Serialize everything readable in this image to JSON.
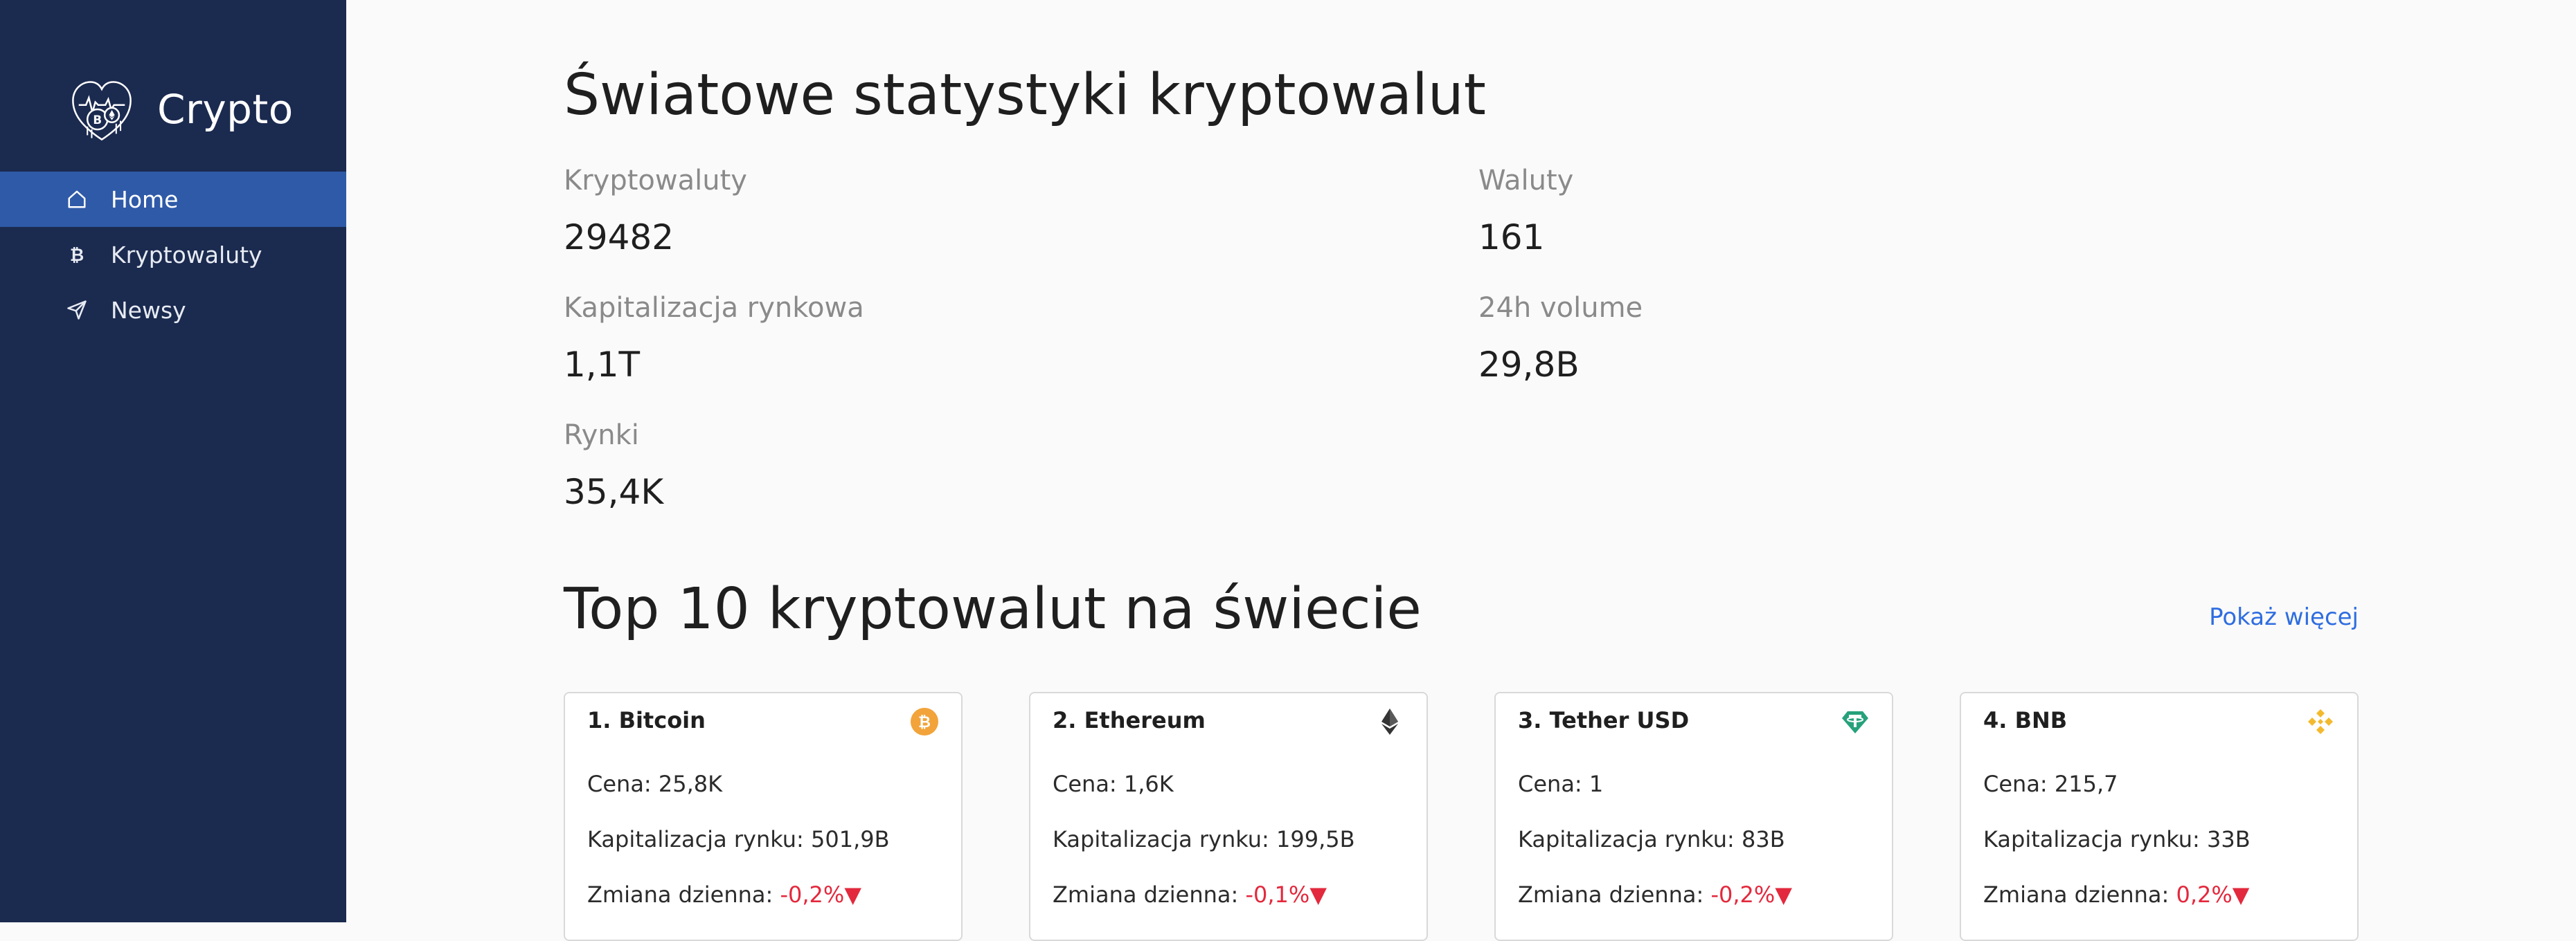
{
  "sidebar": {
    "brand": "Crypto",
    "items": [
      {
        "label": "Home",
        "icon": "home-icon",
        "active": true
      },
      {
        "label": "Kryptowaluty",
        "icon": "bitcoin-icon",
        "active": false
      },
      {
        "label": "Newsy",
        "icon": "send-icon",
        "active": false
      }
    ]
  },
  "main": {
    "title": "Światowe statystyki kryptowalut",
    "stats": {
      "cryptos": {
        "label": "Kryptowaluty",
        "value": "29482"
      },
      "currencies": {
        "label": "Waluty",
        "value": "161"
      },
      "market_cap": {
        "label": "Kapitalizacja rynkowa",
        "value": "1,1T"
      },
      "volume": {
        "label": "24h volume",
        "value": "29,8B"
      },
      "markets": {
        "label": "Rynki",
        "value": "35,4K"
      }
    },
    "top_title": "Top 10 kryptowalut na świecie",
    "show_more": "Pokaż więcej",
    "cards": [
      {
        "title": "1. Bitcoin",
        "icon": "bitcoin-coin-icon",
        "price": "Cena: 25,8K",
        "cap": "Kapitalizacja rynku: 501,9B",
        "change_label": "Zmiana dzienna: ",
        "change_value": "-0,2%"
      },
      {
        "title": "2. Ethereum",
        "icon": "ethereum-icon",
        "price": "Cena: 1,6K",
        "cap": "Kapitalizacja rynku: 199,5B",
        "change_label": "Zmiana dzienna: ",
        "change_value": "-0,1%"
      },
      {
        "title": "3. Tether USD",
        "icon": "tether-icon",
        "price": "Cena: 1",
        "cap": "Kapitalizacja rynku: 83B",
        "change_label": "Zmiana dzienna: ",
        "change_value": "-0,2%"
      },
      {
        "title": "4. BNB",
        "icon": "bnb-icon",
        "price": "Cena: 215,7",
        "cap": "Kapitalizacja rynku: 33B",
        "change_label": "Zmiana dzienna: ",
        "change_value": "0,2%"
      }
    ]
  },
  "colors": {
    "sidebar_bg": "#1b2a4f",
    "active_item": "#2f5aa8",
    "link": "#2f6de0",
    "negative": "#e3293d",
    "bitcoin": "#f2a33a",
    "ethereum": "#343434",
    "tether": "#26a17b",
    "bnb": "#f3ba2f"
  }
}
